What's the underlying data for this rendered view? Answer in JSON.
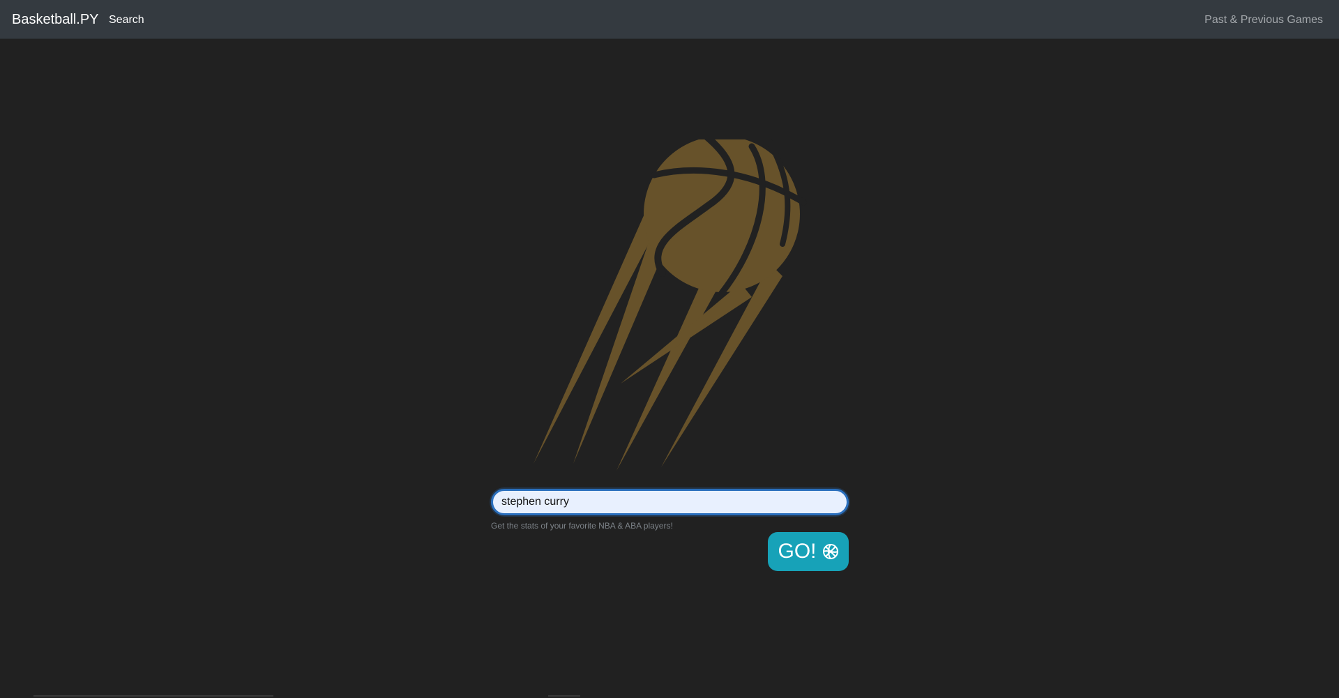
{
  "navbar": {
    "brand": "Basketball.PY",
    "links": {
      "search": "Search",
      "games": "Past & Previous Games"
    }
  },
  "hero": {
    "logo_icon": "flying-basketball-icon",
    "logo_color": "#67522a"
  },
  "search": {
    "value": "stephen curry",
    "helper_text": "Get the stats of your favorite NBA & ABA players!",
    "go_label": "GO!",
    "go_icon": "basketball-icon",
    "go_color": "#17a2b8"
  }
}
